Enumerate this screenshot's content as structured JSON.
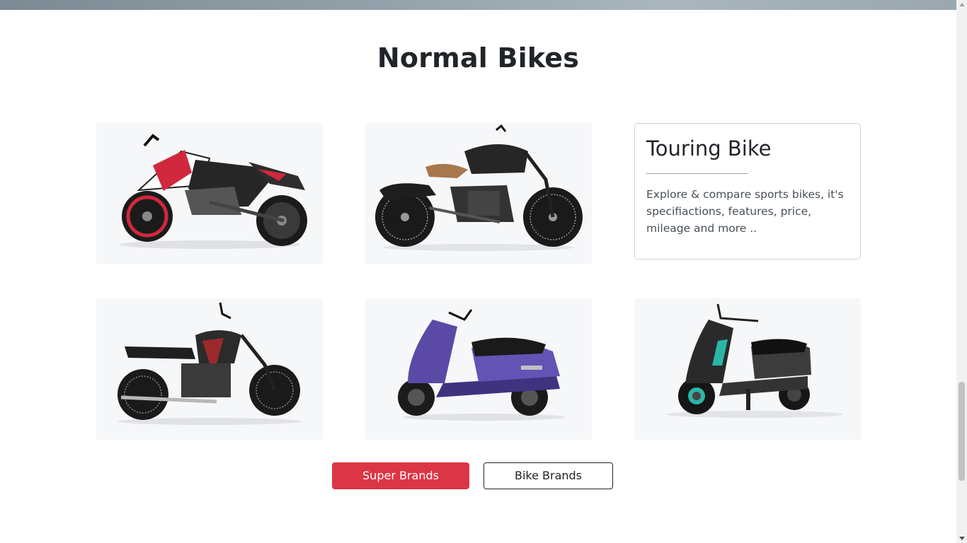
{
  "section": {
    "title": "Normal Bikes"
  },
  "bikes": [
    {
      "icon": "sports-bike-image",
      "accent": "#d0283c",
      "alt": "Sport bike"
    },
    {
      "icon": "cruiser-bike-image",
      "accent": "#a8774c",
      "alt": "Cruiser bike"
    },
    {
      "icon": "scrambler-bike-image",
      "accent": "#9b2a2a",
      "alt": "Scrambler bike"
    },
    {
      "icon": "purple-scooter-image",
      "accent": "#5a4aa6",
      "alt": "Scooter"
    },
    {
      "icon": "electric-scooter-image",
      "accent": "#2bb5a8",
      "alt": "Electric scooter"
    }
  ],
  "info_card": {
    "title": "Touring Bike",
    "description": "Explore & compare sports bikes, it's specifiactions, features, price, mileage and more .."
  },
  "buttons": {
    "super_brands": "Super Brands",
    "bike_brands": "Bike Brands"
  },
  "colors": {
    "primary_red": "#dc3545",
    "title_text": "#212529",
    "card_bg": "#f6f7f9"
  }
}
